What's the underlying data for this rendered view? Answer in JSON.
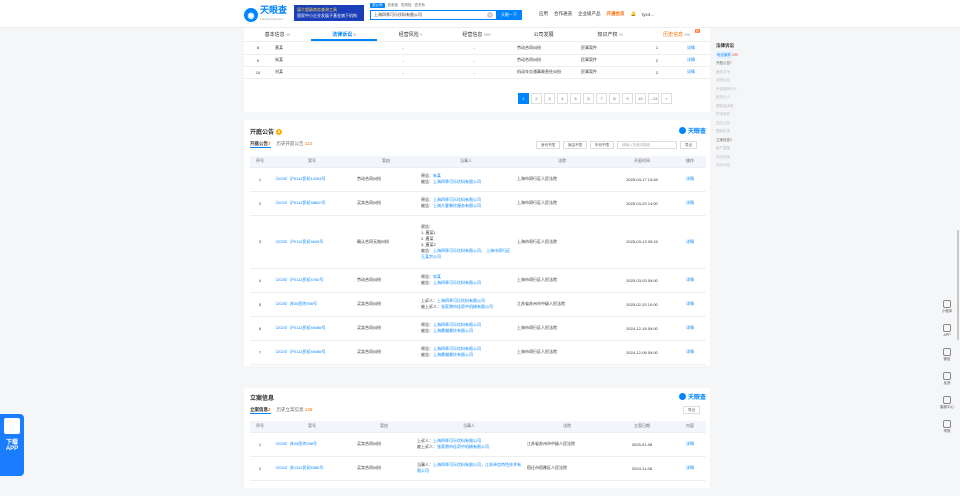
{
  "header": {
    "logo_title": "天眼查",
    "logo_sub": "TianYanCha.com",
    "banner_line1": "媒介超级商务查询工具",
    "banner_line2": "国家中小企业发展子基金旗下机构",
    "search_tabs": [
      "查公司",
      "查老板",
      "查风险",
      "查关系"
    ],
    "search_value": "上海四季可乐饮料有限公司",
    "search_button": "天眼一下",
    "nav": [
      "应用",
      "合作通道",
      "企业级产品",
      "开通会员",
      "tyc4..."
    ]
  },
  "tabs": [
    {
      "label": "基本信息",
      "count": "99"
    },
    {
      "label": "法律诉讼",
      "count": "9"
    },
    {
      "label": "经营风险",
      "count": "9"
    },
    {
      "label": "经营信息",
      "count": "999+"
    },
    {
      "label": "公司发展",
      "count": ""
    },
    {
      "label": "知识产权",
      "count": "99"
    },
    {
      "label": "历史信息",
      "count": "999",
      "hot": "新"
    }
  ],
  "top_rows": [
    [
      "8",
      "黄某",
      "-",
      "-",
      "劳动合同纠纷",
      "民事案件",
      "1",
      "详情"
    ],
    [
      "9",
      "宋某",
      "-",
      "-",
      "劳动合同纠纷",
      "民事案件",
      "2",
      "详情"
    ],
    [
      "10",
      "刘某",
      "-",
      "-",
      "机动车交通事故责任纠纷",
      "民事案件",
      "2",
      "详情"
    ]
  ],
  "pager": [
    "1",
    "2",
    "3",
    "4",
    "5",
    "6",
    "7",
    "8",
    "9",
    "10",
    "...13",
    ">"
  ],
  "court": {
    "title": "开庭公告",
    "badge": "8",
    "brand": "天眼查",
    "tab1": "开庭公告",
    "tab1_n": "7",
    "tab2": "历史开庭公告",
    "tab2_n": "113",
    "filters": [
      "身份不限",
      "案由不限",
      "年份不限",
      "请输入关键词搜索",
      "导出"
    ],
    "headers": [
      "序号",
      "案号",
      "案由",
      "当事人",
      "法院",
      "开庭时间",
      "操作"
    ],
    "rows": [
      {
        "no": "1",
        "case": "（2025）沪0112民初12264号",
        "reason": "劳动合同纠纷",
        "parties": [
          [
            "原告：",
            "朱某"
          ],
          [
            "被告：",
            "上海四季可乐饮料有限公司"
          ]
        ],
        "court": "上海市闵行区人民法院",
        "date": "2025-04-17 13:45",
        "op": "详情"
      },
      {
        "no": "2",
        "case": "（2024）沪0112民初48820号",
        "reason": "买卖合同纠纷",
        "parties": [
          [
            "原告：",
            "上海四季可乐饮料有限公司"
          ],
          [
            "被告：",
            "上海大客餐饮服务有限公司"
          ]
        ],
        "court": "上海市闵行区人民法院",
        "date": "2025-03-20 14:00",
        "op": "详情"
      },
      {
        "no": "3",
        "case": "（2025）沪0112民初4645号",
        "reason": "确认合同无效纠纷",
        "parties": [
          [
            "原告：",
            ""
          ],
          [
            "1. 唐某1",
            ""
          ],
          [
            "2. 唐某",
            ""
          ],
          [
            "3. 唐某2",
            ""
          ],
          [
            "被告：",
            "上海四季可乐饮料有限公司， 上海市闵行区王某宗公司"
          ]
        ],
        "court": "上海市闵行区人民法院",
        "date": "2025-03-13 09:15",
        "op": "详情"
      },
      {
        "no": "4",
        "case": "（2025）沪0112民初4760号",
        "reason": "劳动合同纠纷",
        "parties": [
          [
            "原告：",
            "宋某"
          ],
          [
            "被告：",
            "上海四季可乐饮料有限公司"
          ]
        ],
        "court": "上海市闵行区人民法院",
        "date": "2025-03-03 09:00",
        "op": "详情"
      },
      {
        "no": "5",
        "case": "（2025）苏05民终398号",
        "reason": "买卖合同纠纷",
        "parties": [
          [
            "上诉人：",
            "上海四季可乐饮料有限公司"
          ],
          [
            "被上诉人：",
            "张家港市佳奇中机械有限公司"
          ]
        ],
        "court": "江苏省苏州市中级人民法院",
        "date": "2025-02-20 10:00",
        "op": "详情"
      },
      {
        "no": "6",
        "case": "（2024）沪0112民初49486号",
        "reason": "买卖合同纠纷",
        "parties": [
          [
            "原告：",
            "上海四季可乐饮料有限公司"
          ],
          [
            "被告：",
            "上海鼎福餐饮有限公司"
          ]
        ],
        "court": "上海市闵行区人民法院",
        "date": "2024-12-16 09:00",
        "op": "详情"
      },
      {
        "no": "7",
        "case": "（2024）沪0112民初49486号",
        "reason": "买卖合同纠纷",
        "parties": [
          [
            "原告：",
            "上海四季可乐饮料有限公司"
          ],
          [
            "被告：",
            "上海鼎福餐饮有限公司"
          ]
        ],
        "court": "上海市闵行区人民法院",
        "date": "2024-12-06 09:00",
        "op": "详情"
      }
    ]
  },
  "filing": {
    "title": "立案信息",
    "badge": "2",
    "brand": "天眼查",
    "tab1": "立案信息",
    "tab1_n": "2",
    "tab2": "历史立案信息",
    "tab2_n": "149",
    "export": "导出",
    "headers": [
      "序号",
      "案号",
      "案由",
      "当事人",
      "法院",
      "立案日期",
      "内容"
    ],
    "rows": [
      {
        "no": "1",
        "case": "（2025）苏05民终398号",
        "reason": "买卖合同纠纷",
        "parties": [
          [
            "上诉人：",
            "上海四季可乐饮料有限公司"
          ],
          [
            "被上诉人：",
            "张家港市佳奇中机械有限公司"
          ]
        ],
        "court": "江苏省苏州市中级人民法院",
        "date": "2025-01-08",
        "op": "详情"
      },
      {
        "no": "2",
        "case": "（2024）苏1311民初6385号",
        "reason": "买卖合同纠纷",
        "parties": [
          [
            "当事人：",
            "上海四季可乐饮料有限公司，江苏卓信特色技术有限公司"
          ]
        ],
        "court": "宿迁市宿豫区人民法院",
        "date": "2024-11-08",
        "op": "详情"
      }
    ]
  },
  "right_nav": {
    "title": "法律诉讼",
    "items": [
      {
        "label": "司法案件",
        "n": "299",
        "active": true
      },
      {
        "label": "开庭公告",
        "n": "7",
        "dark": true
      },
      {
        "label": "裁判文书",
        "n": ""
      },
      {
        "label": "法院公告",
        "n": ""
      },
      {
        "label": "失信被执行人",
        "n": ""
      },
      {
        "label": "被执行人",
        "n": ""
      },
      {
        "label": "限制高消费",
        "n": ""
      },
      {
        "label": "终本案件",
        "n": ""
      },
      {
        "label": "送达公告",
        "n": ""
      },
      {
        "label": "限制出境",
        "n": ""
      },
      {
        "label": "立案信息",
        "n": "2",
        "dark": true
      },
      {
        "label": "破产重整",
        "n": ""
      },
      {
        "label": "司法拍卖",
        "n": ""
      },
      {
        "label": "询价评估",
        "n": ""
      }
    ]
  },
  "floating": [
    "小程序",
    "APP",
    "微信",
    "反馈",
    "客服中心",
    "举报"
  ],
  "app_badge": [
    "下载",
    "APP"
  ]
}
